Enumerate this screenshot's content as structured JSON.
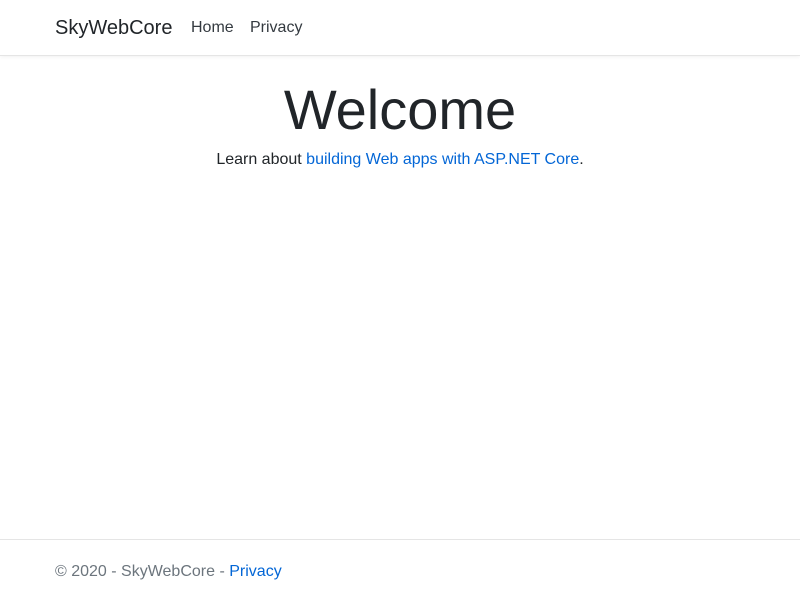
{
  "navbar": {
    "brand": "SkyWebCore",
    "links": [
      {
        "label": "Home"
      },
      {
        "label": "Privacy"
      }
    ]
  },
  "main": {
    "title": "Welcome",
    "text_prefix": "Learn about ",
    "link_text": "building Web apps with ASP.NET Core",
    "text_suffix": "."
  },
  "footer": {
    "copyright": "© 2020 - SkyWebCore - ",
    "privacy_link": "Privacy"
  },
  "colors": {
    "link": "#0366d6",
    "text": "#212529",
    "muted": "#6c757d",
    "border": "#e5e5e5"
  }
}
